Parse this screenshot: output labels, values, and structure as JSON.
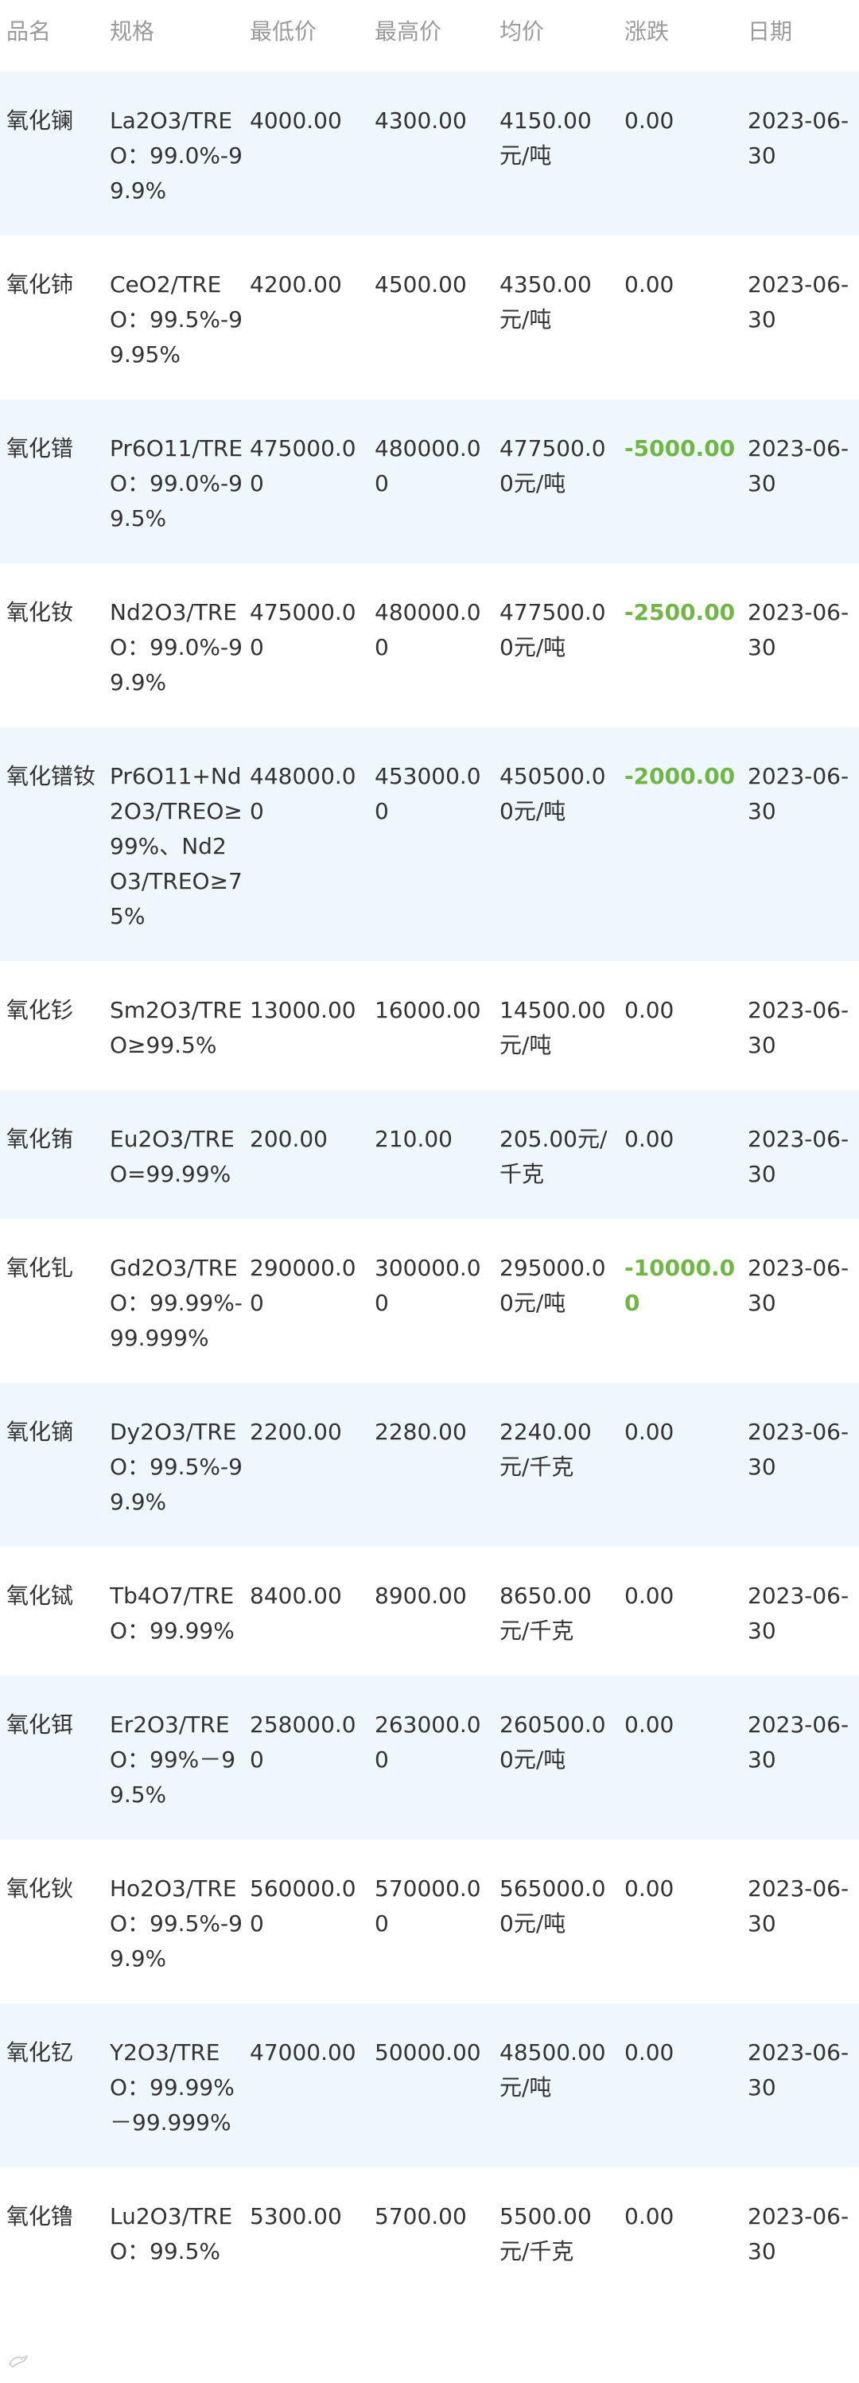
{
  "header": {
    "name": "品名",
    "spec": "规格",
    "low": "最低价",
    "high": "最高价",
    "avg": "均价",
    "change": "涨跌",
    "date": "日期"
  },
  "rows": [
    {
      "name": "氧化镧",
      "spec": "La2O3/TREO：99.0%-99.9%",
      "low": "4000.00",
      "high": "4300.00",
      "avg": "4150.00元/吨",
      "change": "0.00",
      "date": "2023-06-30"
    },
    {
      "name": "氧化铈",
      "spec": "CeO2/TREO：99.5%-99.95%",
      "low": "4200.00",
      "high": "4500.00",
      "avg": "4350.00元/吨",
      "change": "0.00",
      "date": "2023-06-30"
    },
    {
      "name": "氧化镨",
      "spec": "Pr6O11/TREO：99.0%-99.5%",
      "low": "475000.00",
      "high": "480000.00",
      "avg": "477500.00元/吨",
      "change": "-5000.00",
      "date": "2023-06-30"
    },
    {
      "name": "氧化钕",
      "spec": "Nd2O3/TREO：99.0%-99.9%",
      "low": "475000.00",
      "high": "480000.00",
      "avg": "477500.00元/吨",
      "change": "-2500.00",
      "date": "2023-06-30"
    },
    {
      "name": "氧化镨钕",
      "spec": "Pr6O11+Nd2O3/TREO≥99%、Nd2O3/TREO≥75%",
      "low": "448000.00",
      "high": "453000.00",
      "avg": "450500.00元/吨",
      "change": "-2000.00",
      "date": "2023-06-30"
    },
    {
      "name": "氧化钐",
      "spec": "Sm2O3/TREO≥99.5%",
      "low": "13000.00",
      "high": "16000.00",
      "avg": "14500.00元/吨",
      "change": "0.00",
      "date": "2023-06-30"
    },
    {
      "name": "氧化铕",
      "spec": "Eu2O3/TREO=99.99%",
      "low": "200.00",
      "high": "210.00",
      "avg": "205.00元/千克",
      "change": "0.00",
      "date": "2023-06-30"
    },
    {
      "name": "氧化钆",
      "spec": "Gd2O3/TREO：99.99%-99.999%",
      "low": "290000.00",
      "high": "300000.00",
      "avg": "295000.00元/吨",
      "change": "-10000.00",
      "date": "2023-06-30"
    },
    {
      "name": "氧化镝",
      "spec": "Dy2O3/TREO：99.5%-99.9%",
      "low": "2200.00",
      "high": "2280.00",
      "avg": "2240.00元/千克",
      "change": "0.00",
      "date": "2023-06-30"
    },
    {
      "name": "氧化铽",
      "spec": "Tb4O7/TREO：99.99%",
      "low": "8400.00",
      "high": "8900.00",
      "avg": "8650.00元/千克",
      "change": "0.00",
      "date": "2023-06-30"
    },
    {
      "name": "氧化铒",
      "spec": "Er2O3/TREO：99%－99.5%",
      "low": "258000.00",
      "high": "263000.00",
      "avg": "260500.00元/吨",
      "change": "0.00",
      "date": "2023-06-30"
    },
    {
      "name": "氧化钬",
      "spec": "Ho2O3/TREO：99.5%-99.9%",
      "low": "560000.00",
      "high": "570000.00",
      "avg": "565000.00元/吨",
      "change": "0.00",
      "date": "2023-06-30"
    },
    {
      "name": "氧化钇",
      "spec": "Y2O3/TREO：99.99%－99.999%",
      "low": "47000.00",
      "high": "50000.00",
      "avg": "48500.00元/吨",
      "change": "0.00",
      "date": "2023-06-30"
    },
    {
      "name": "氧化镥",
      "spec": "Lu2O3/TREO：99.5%",
      "low": "5300.00",
      "high": "5700.00",
      "avg": "5500.00元/千克",
      "change": "0.00",
      "date": "2023-06-30"
    }
  ],
  "colors": {
    "row_tint": "#eef7fb",
    "negative_change": "#6fb644",
    "header_text": "#9a9a9a"
  },
  "watermark": {
    "icon": "bird-logo-icon"
  }
}
